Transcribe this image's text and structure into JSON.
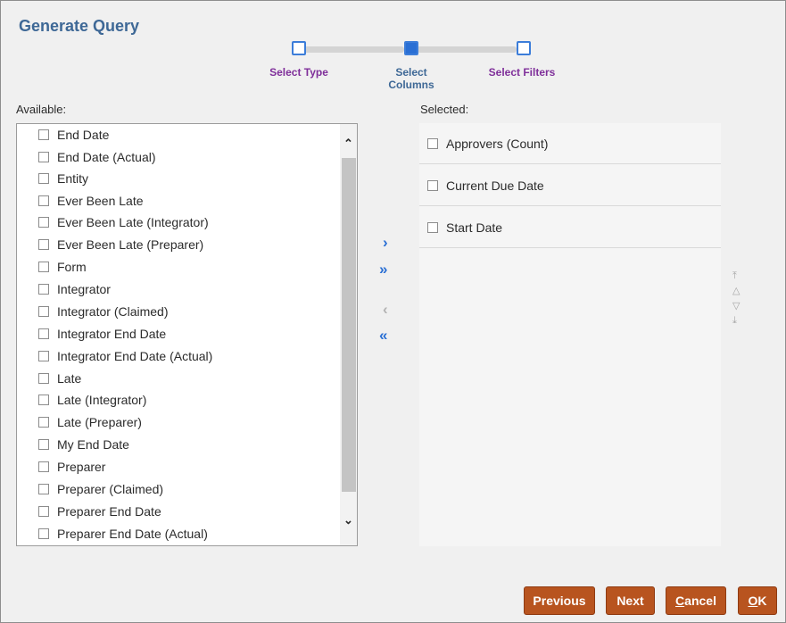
{
  "dialog": {
    "title": "Generate Query"
  },
  "wizard": {
    "steps": [
      {
        "label": "Select Type",
        "state": "visited"
      },
      {
        "label_line1": "Select",
        "label_line2": "Columns",
        "state": "current"
      },
      {
        "label": "Select Filters",
        "state": "upcoming"
      }
    ]
  },
  "available": {
    "label": "Available:",
    "items": [
      "End Date",
      "End Date (Actual)",
      "Entity",
      "Ever Been Late",
      "Ever Been Late (Integrator)",
      "Ever Been Late (Preparer)",
      "Form",
      "Integrator",
      "Integrator (Claimed)",
      "Integrator End Date",
      "Integrator End Date (Actual)",
      "Late",
      "Late (Integrator)",
      "Late (Preparer)",
      "My End Date",
      "Preparer",
      "Preparer (Claimed)",
      "Preparer End Date",
      "Preparer End Date (Actual)"
    ]
  },
  "selected": {
    "label": "Selected:",
    "items": [
      "Approvers (Count)",
      "Current Due Date",
      "Start Date"
    ]
  },
  "shuttle": {
    "move_icon": "chevron-right-icon",
    "move_all_icon": "double-chevron-right-icon",
    "remove_icon": "chevron-left-icon",
    "remove_all_icon": "double-chevron-left-icon"
  },
  "buttons": {
    "previous": "Previous",
    "next": "Next",
    "cancel_first": "C",
    "cancel_rest": "ancel",
    "ok_first": "O",
    "ok_rest": "K"
  },
  "colors": {
    "title": "#3e6896",
    "step_label": "#7f2f9a",
    "accent_blue": "#2a6fd4",
    "button": "#b8541f"
  }
}
